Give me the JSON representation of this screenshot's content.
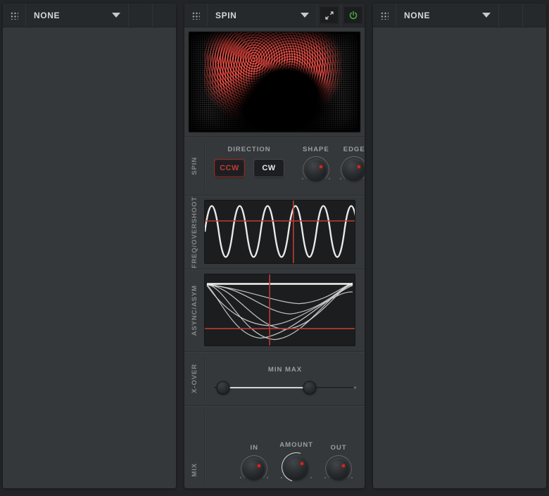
{
  "colors": {
    "accent_red": "#c23b34",
    "power_green": "#44a73b",
    "panel_bg": "#35383b",
    "header_bg": "#26292b",
    "graph_bg": "#1b1d1f",
    "wave_white": "#e9eaea"
  },
  "left_slot": {
    "selector": "NONE",
    "icons": [
      "drag-handle-icon",
      "dropdown-arrow-icon"
    ]
  },
  "right_slot": {
    "selector": "NONE",
    "icons": [
      "drag-handle-icon",
      "dropdown-arrow-icon"
    ]
  },
  "spin_module": {
    "selector": "SPIN",
    "power_state": "on",
    "icons": [
      "drag-handle-icon",
      "dropdown-arrow-icon",
      "expand-icon",
      "power-icon"
    ],
    "sections": {
      "spin": "SPIN",
      "freq": "FREQ/OVERSHOOT",
      "async": "ASYNC/ASYM",
      "xover": "X-OVER",
      "mix": "MIX"
    },
    "direction": {
      "title": "DIRECTION",
      "ccw": "CCW",
      "cw": "CW",
      "selected": "CCW"
    },
    "knobs": {
      "shape": "SHAPE",
      "edge": "EDGE",
      "in": "IN",
      "amount": "AMOUNT",
      "out": "OUT"
    },
    "xover": {
      "range_label": "MIN MAX",
      "min_handle_pos": "6.5%",
      "max_handle_pos": "67.5%"
    }
  }
}
